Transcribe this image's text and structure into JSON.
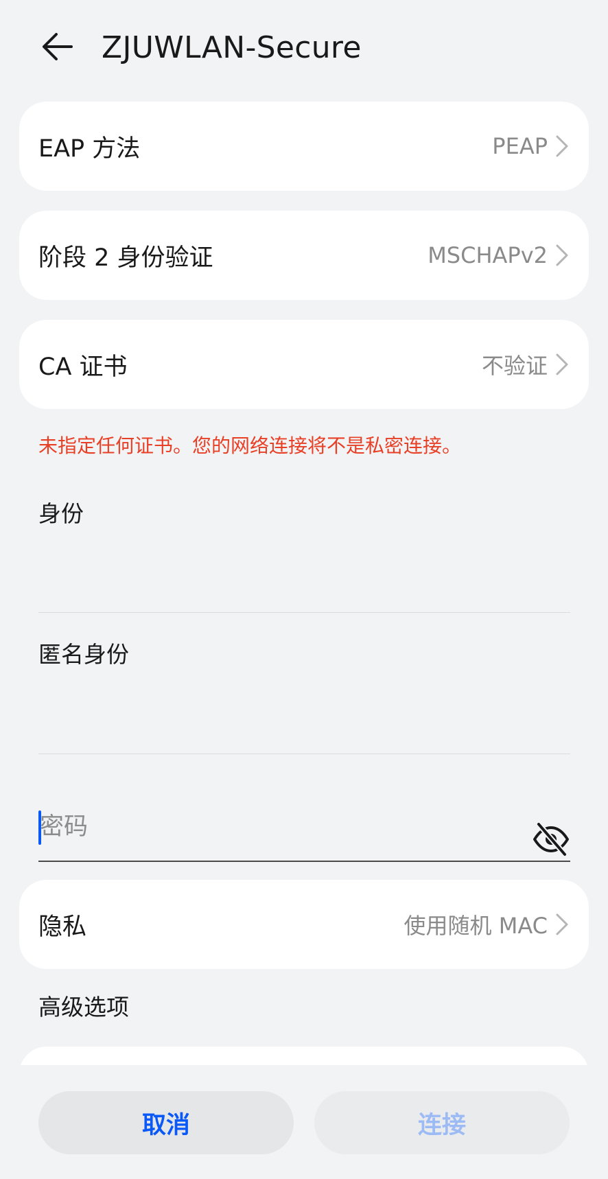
{
  "header": {
    "title": "ZJUWLAN-Secure",
    "back_icon": "arrow-left-icon"
  },
  "settings": {
    "eap_method": {
      "label": "EAP 方法",
      "value": "PEAP"
    },
    "phase2_auth": {
      "label": "阶段 2 身份验证",
      "value": "MSCHAPv2"
    },
    "ca_cert": {
      "label": "CA 证书",
      "value": "不验证"
    },
    "warning": "未指定任何证书。您的网络连接将不是私密连接。"
  },
  "fields": {
    "identity": {
      "label": "身份",
      "value": ""
    },
    "anonymous_identity": {
      "label": "匿名身份",
      "value": ""
    },
    "password": {
      "placeholder": "密码",
      "value": "",
      "toggle_icon": "eye-off-icon"
    }
  },
  "privacy": {
    "label": "隐私",
    "value": "使用随机 MAC"
  },
  "advanced": {
    "title": "高级选项"
  },
  "actions": {
    "cancel": "取消",
    "connect": "连接"
  },
  "colors": {
    "background": "#f1f3f5",
    "accent": "#0a59f7",
    "warning": "#e84026",
    "disabled_accent": "#9cbbf5"
  }
}
